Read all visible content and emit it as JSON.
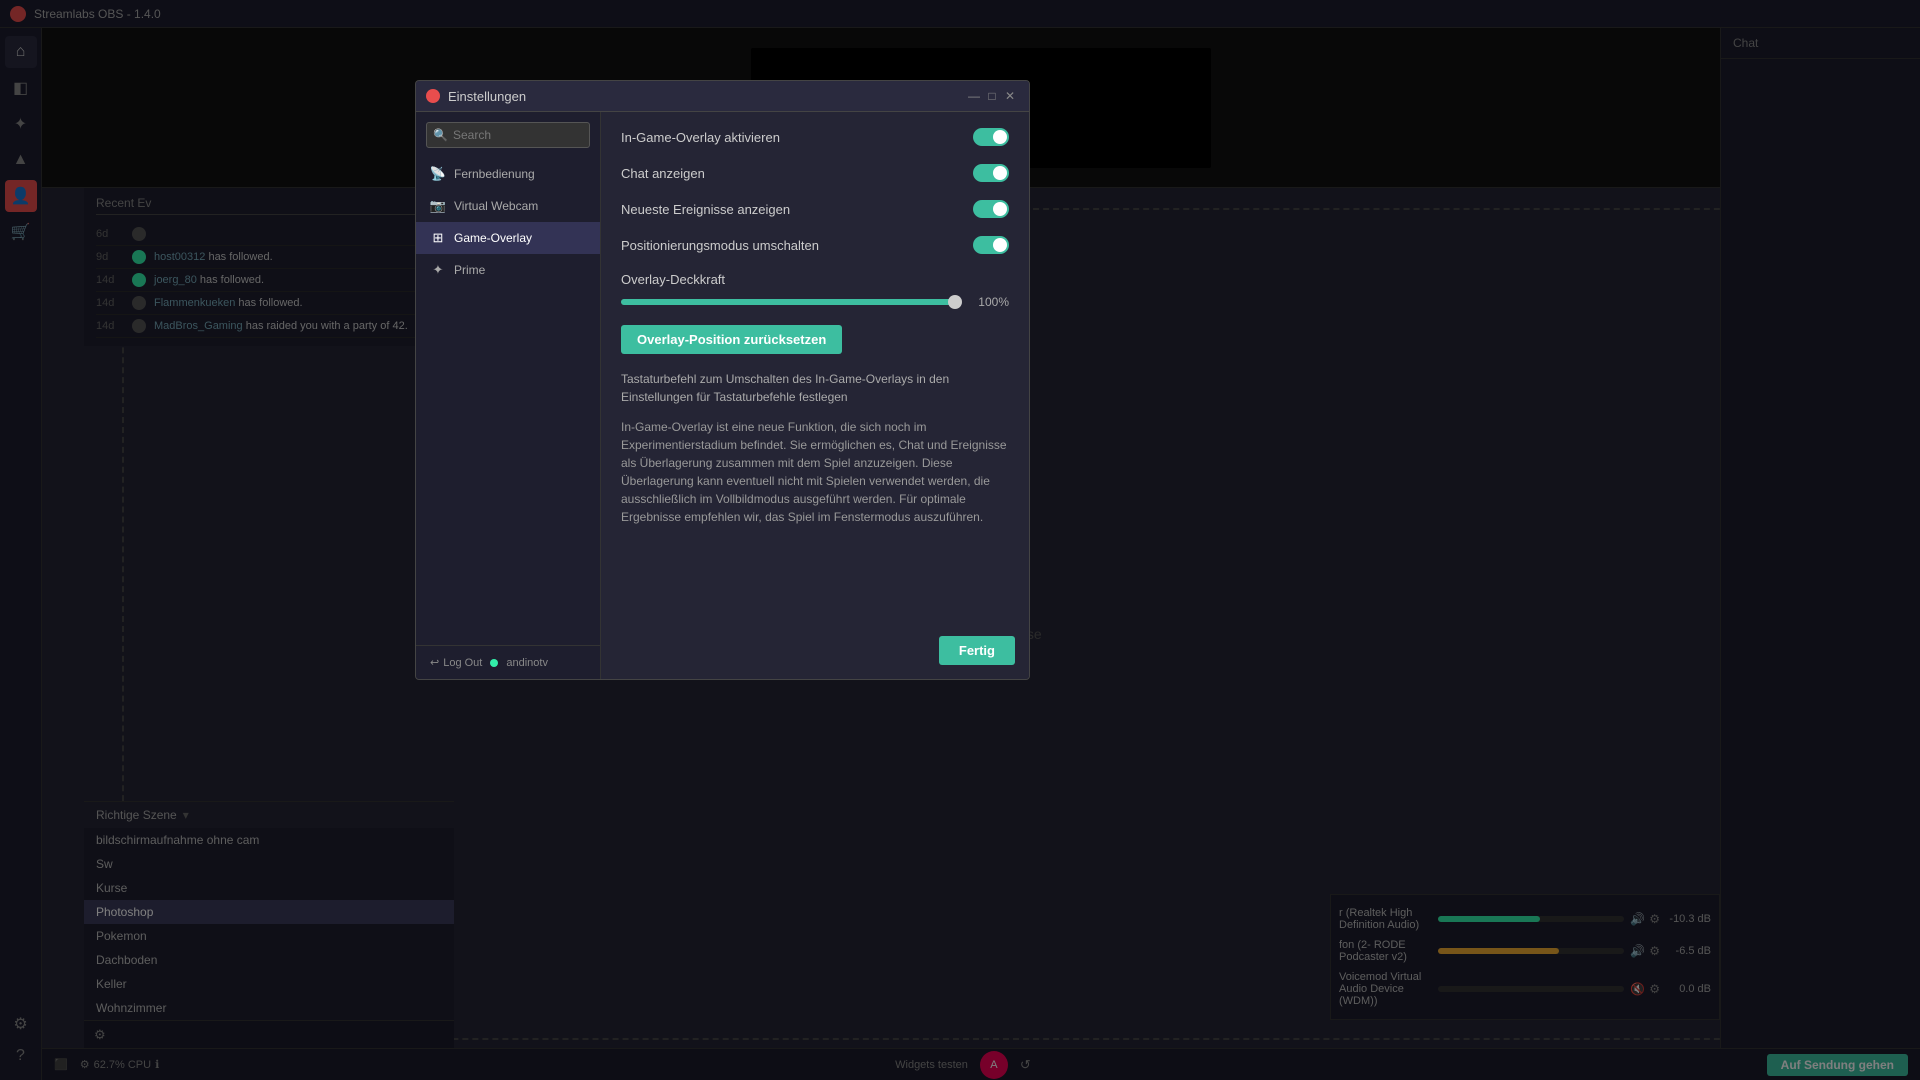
{
  "app": {
    "title": "Streamlabs OBS - 1.4.0"
  },
  "titlebar": {
    "title": "Streamlabs OBS - 1.4.0"
  },
  "sidebar": {
    "icons": [
      {
        "name": "home-icon",
        "symbol": "⌂",
        "active": true
      },
      {
        "name": "theme-icon",
        "symbol": "◧"
      },
      {
        "name": "star-icon",
        "symbol": "✦"
      },
      {
        "name": "chart-icon",
        "symbol": "▲"
      },
      {
        "name": "user-icon",
        "symbol": "👤",
        "highlight": true
      },
      {
        "name": "shop-icon",
        "symbol": "🛒"
      }
    ]
  },
  "recent_events": {
    "title": "Recent Ev",
    "events": [
      {
        "age": "6d",
        "text": "",
        "link": "",
        "type": "blank"
      },
      {
        "age": "9d",
        "link": "host00312",
        "text": " has followed.",
        "type": "follow"
      },
      {
        "age": "14d",
        "link": "joerg_80",
        "text": " has followed.",
        "type": "follow"
      },
      {
        "age": "14d",
        "link": "Flammenkueken",
        "text": " has followed.",
        "type": "follow"
      },
      {
        "age": "14d",
        "link": "MadBros_Gaming",
        "text": " has raided you with a party of 42.",
        "type": "raid"
      }
    ]
  },
  "scene_canvas": {
    "label": "Neueste Ereignisse"
  },
  "scenes": {
    "header": "Richtige Szene",
    "items": [
      {
        "label": "bildschirmaufnahme ohne cam"
      },
      {
        "label": "Sw"
      },
      {
        "label": "Kurse"
      },
      {
        "label": "Photoshop",
        "active": true
      },
      {
        "label": "Pokemon"
      },
      {
        "label": "Dachboden"
      },
      {
        "label": "Keller"
      },
      {
        "label": "Wohnzimmer"
      }
    ]
  },
  "chat": {
    "title": "Chat"
  },
  "audio_mixer": {
    "channels": [
      {
        "label": "r (Realtek High Definition Audio)",
        "db": "-10.3 dB",
        "fill_pct": 55
      },
      {
        "label": "fon (2- RODE Podcaster v2)",
        "db": "-6.5 dB",
        "fill_pct": 65
      },
      {
        "label": "Voicemod Virtual Audio Device (WDM))",
        "db": "0.0 dB",
        "fill_pct": 0
      }
    ]
  },
  "bottom_bar": {
    "chart_label": "⬛",
    "cpu_label": "62.7% CPU",
    "info_icon": "ℹ",
    "widgets_btn": "Widgets testen",
    "go_live_btn": "Auf Sendung gehen"
  },
  "settings_modal": {
    "title": "Einstellungen",
    "window_buttons": [
      "—",
      "□",
      "✕"
    ],
    "search_placeholder": "Search",
    "nav_items": [
      {
        "label": "Fernbedienung",
        "icon": "📡"
      },
      {
        "label": "Virtual Webcam",
        "icon": "📷"
      },
      {
        "label": "Game-Overlay",
        "icon": "⊞",
        "active": true
      },
      {
        "label": "Prime",
        "icon": "✦"
      }
    ],
    "footer": {
      "logout_label": "Log Out",
      "user_label": "andinotv"
    },
    "content": {
      "toggle_sections": [
        {
          "label": "In-Game-Overlay aktivieren",
          "state": "on"
        },
        {
          "label": "Chat anzeigen",
          "state": "on"
        },
        {
          "label": "Neueste Ereignisse anzeigen",
          "state": "on"
        },
        {
          "label": "Positionierungsmodus umschalten",
          "state": "on"
        }
      ],
      "opacity_label": "Overlay-Deckkraft",
      "opacity_value": "100%",
      "reset_btn_label": "Overlay-Position zurücksetzen",
      "keyboard_shortcut_text": "Tastaturbefehl zum Umschalten des In-Game-Overlays in den Einstellungen für Tastaturbefehle festlegen",
      "description": "In-Game-Overlay ist eine neue Funktion, die sich noch im Experimentierstadium befindet. Sie ermöglichen es, Chat und Ereignisse als Überlagerung zusammen mit dem Spiel anzuzeigen. Diese Überlagerung kann eventuell nicht mit Spielen verwendet werden, die ausschließlich im Vollbildmodus ausgeführt werden. Für optimale Ergebnisse empfehlen wir, das Spiel im Fenstermodus auszuführen.",
      "done_btn_label": "Fertig"
    }
  }
}
